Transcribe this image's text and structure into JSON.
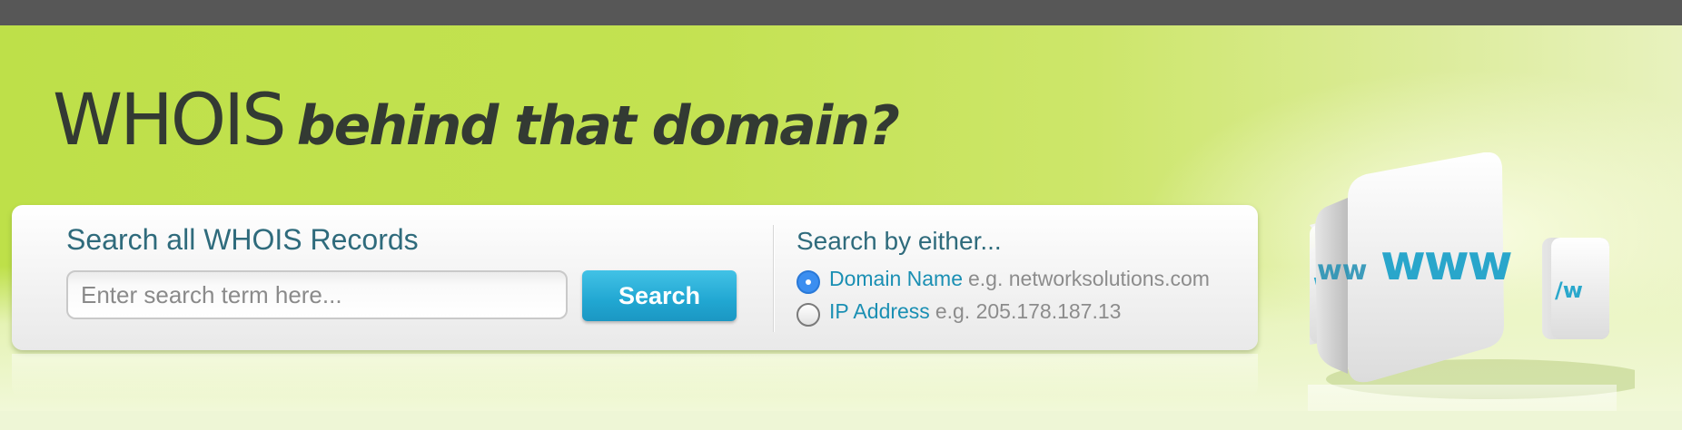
{
  "hero": {
    "brand": "WHOIS",
    "tagline": "behind that domain?"
  },
  "search": {
    "title": "Search all WHOIS Records",
    "placeholder": "Enter search term here...",
    "button_label": "Search"
  },
  "search_by": {
    "title": "Search by either...",
    "options": [
      {
        "label": "Domain Name",
        "example": "e.g. networksolutions.com",
        "selected": true
      },
      {
        "label": "IP Address",
        "example": "e.g. 205.178.187.13",
        "selected": false
      }
    ]
  },
  "graphic": {
    "cube_text": "www"
  },
  "colors": {
    "hero_green": "#c3e251",
    "accent_blue": "#21a7d2",
    "title_teal": "#2f6b7c",
    "topbar": "#575757"
  }
}
